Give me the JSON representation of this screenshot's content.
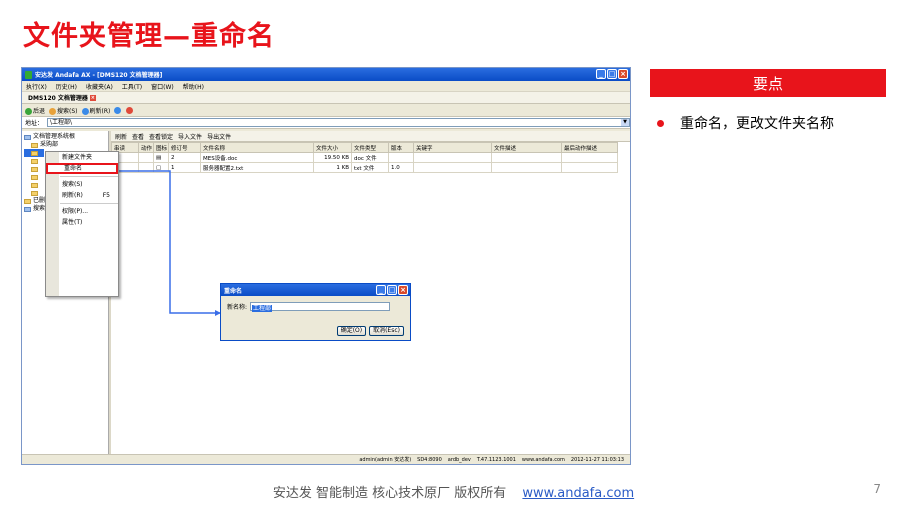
{
  "slide": {
    "title": "文件夹管理—重命名",
    "key_points_header": "要点",
    "bullet": "重命名，更改文件夹名称",
    "footer_text": "安达发   智能制造 核心技术原厂    版权所有",
    "footer_link": "www.andafa.com",
    "page_number": "7"
  },
  "app": {
    "window_title": "安达发 Andafa AX - [DMS120 文档管理器]",
    "menu": [
      "执行(X)",
      "历史(H)",
      "收藏夹(A)",
      "工具(T)",
      "窗口(W)",
      "帮助(H)"
    ],
    "tab_label": "DMS120 文档管理器",
    "toolbar": [
      "后退",
      "搜索(S)",
      "刷新(R)"
    ],
    "address_label": "地址：",
    "address_value": "\\工程部\\",
    "tree": [
      "文档管理系统根",
      "采购部",
      "工程部",
      "",
      "",
      "",
      "",
      "",
      "已删",
      "搜索"
    ],
    "list_toolbar": [
      "刷新",
      "查看",
      "查看锁定",
      "导入文件",
      "导出文件"
    ],
    "columns": [
      "串读",
      "动作",
      "图标",
      "修订号",
      "文件名称",
      "文件大小",
      "文件类型",
      "版本",
      "关键字",
      "文件描述",
      "最后动作描述"
    ],
    "rows": [
      {
        "rev": "2",
        "name": "MES设备.doc",
        "size": "19.50 KB",
        "type": "doc 文件",
        "ver": ""
      },
      {
        "rev": "1",
        "name": "服务器配置2.txt",
        "size": "1 KB",
        "type": "txt 文件",
        "ver": "1.0"
      }
    ],
    "context_menu": [
      {
        "label": "新建文件夹",
        "shortcut": ""
      },
      {
        "label": "重命名",
        "shortcut": ""
      },
      {
        "label": "搜索(S)",
        "shortcut": ""
      },
      {
        "label": "刷新(R)",
        "shortcut": "F5"
      },
      {
        "label": "权限(P)...",
        "shortcut": ""
      },
      {
        "label": "属性(T)",
        "shortcut": ""
      }
    ],
    "status": [
      "admin(admin 安达发)",
      "SD4:8090",
      "ardb_dev",
      "T.47.1123.1001",
      "www.andafa.com",
      "2012-11-27 11:03:13"
    ]
  },
  "dialog": {
    "title": "重命名",
    "label": "新名称:",
    "value": "工程部",
    "ok": "确定(O)",
    "cancel": "取消(Esc)"
  },
  "colors": {
    "accent": "#e8141b",
    "xp_blue": "#0a4cc6"
  }
}
